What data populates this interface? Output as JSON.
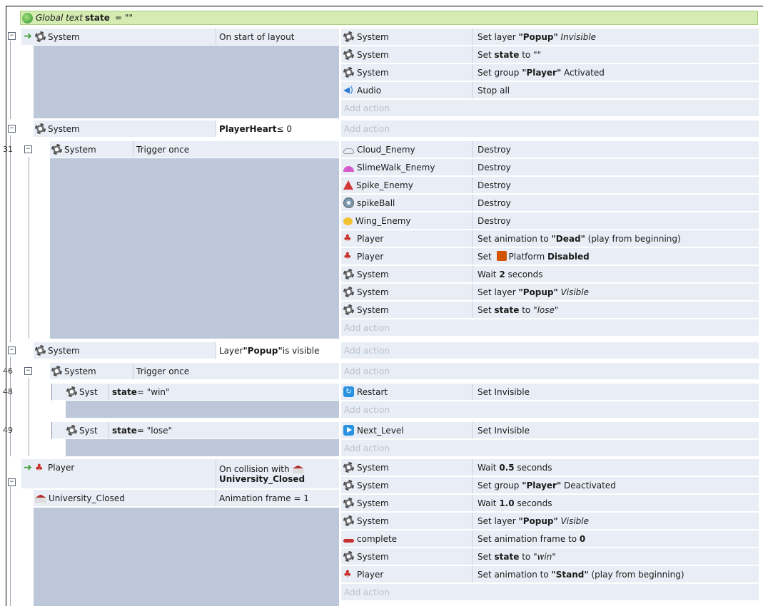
{
  "global_var": {
    "prefix": "Global text",
    "name": "state",
    "equals": "=",
    "value": "\"\""
  },
  "event_numbers": [
    "31",
    "46",
    "48",
    "49"
  ],
  "events": [
    {
      "conditions": [
        {
          "object": "System",
          "text": "On start of layout"
        }
      ],
      "actions": [
        {
          "object": "System",
          "parts": [
            "Set layer ",
            "\"Popup\"",
            " ",
            "Invisible"
          ]
        },
        {
          "object": "System",
          "parts": [
            "Set ",
            "state",
            " to ",
            "\"\""
          ]
        },
        {
          "object": "System",
          "parts": [
            "Set group ",
            "\"Player\"",
            " Activated"
          ]
        },
        {
          "object": "Audio",
          "parts": [
            "Stop all"
          ]
        }
      ]
    },
    {
      "conditions": [
        {
          "object": "System",
          "text_bold": "PlayerHeart",
          "text_rest": " ≤ 0"
        }
      ]
    },
    {
      "conditions": [
        {
          "object": "System",
          "text": "Trigger once"
        }
      ],
      "actions": [
        {
          "object": "Cloud_Enemy",
          "parts": [
            "Destroy"
          ]
        },
        {
          "object": "SlimeWalk_Enemy",
          "parts": [
            "Destroy"
          ]
        },
        {
          "object": "Spike_Enemy",
          "parts": [
            "Destroy"
          ]
        },
        {
          "object": "spikeBall",
          "parts": [
            "Destroy"
          ]
        },
        {
          "object": "Wing_Enemy",
          "parts": [
            "Destroy"
          ]
        },
        {
          "object": "Player",
          "parts": [
            "Set animation to ",
            "\"Dead\"",
            " (play from beginning)"
          ]
        },
        {
          "object": "Player",
          "parts": [
            "Set ",
            "Platform ",
            "Disabled"
          ]
        },
        {
          "object": "System",
          "parts": [
            "Wait ",
            "2",
            " seconds"
          ]
        },
        {
          "object": "System",
          "parts": [
            "Set layer ",
            "\"Popup\"",
            " ",
            "Visible"
          ]
        },
        {
          "object": "System",
          "parts": [
            "Set ",
            "state",
            " to ",
            "\"lose\""
          ]
        }
      ]
    },
    {
      "conditions": [
        {
          "object": "System",
          "text_pre": "Layer ",
          "text_bold": "\"Popup\"",
          "text_rest": " is visible"
        }
      ]
    },
    {
      "conditions": [
        {
          "object": "System",
          "text": "Trigger once"
        }
      ]
    },
    {
      "conditions": [
        {
          "object": "Syst",
          "text_bold": "state",
          "text_rest": " = \"win\""
        }
      ],
      "actions": [
        {
          "object": "Restart",
          "parts": [
            "Set Invisible"
          ]
        }
      ]
    },
    {
      "conditions": [
        {
          "object": "Syst",
          "text_bold": "state",
          "text_rest": " = \"lose\""
        }
      ],
      "actions": [
        {
          "object": "Next_Level",
          "parts": [
            "Set Invisible"
          ]
        }
      ]
    },
    {
      "conditions": [
        {
          "object": "Player",
          "text_pre": "On collision with",
          "text_bold": "University_Closed"
        },
        {
          "object": "University_Closed",
          "text": "Animation frame = 1"
        }
      ],
      "actions": [
        {
          "object": "System",
          "parts": [
            "Wait ",
            "0.5",
            " seconds"
          ]
        },
        {
          "object": "System",
          "parts": [
            "Set group ",
            "\"Player\"",
            " Deactivated"
          ]
        },
        {
          "object": "System",
          "parts": [
            "Wait ",
            "1.0",
            " seconds"
          ]
        },
        {
          "object": "System",
          "parts": [
            "Set layer ",
            "\"Popup\"",
            " ",
            "Visible"
          ]
        },
        {
          "object": "complete",
          "parts": [
            "Set animation frame to ",
            "0"
          ]
        },
        {
          "object": "System",
          "parts": [
            "Set ",
            "state",
            " to ",
            "\"win\""
          ]
        },
        {
          "object": "Player",
          "parts": [
            "Set animation to ",
            "\"Stand\"",
            " (play from beginning)"
          ]
        }
      ]
    }
  ],
  "add_action_label": "Add action",
  "collapse_glyph": "−",
  "icons": {
    "system": "gear-icon",
    "audio": "speaker-icon",
    "player": "player-sprite-icon",
    "global": "globe-icon",
    "trigger": "green-arrow-icon"
  }
}
